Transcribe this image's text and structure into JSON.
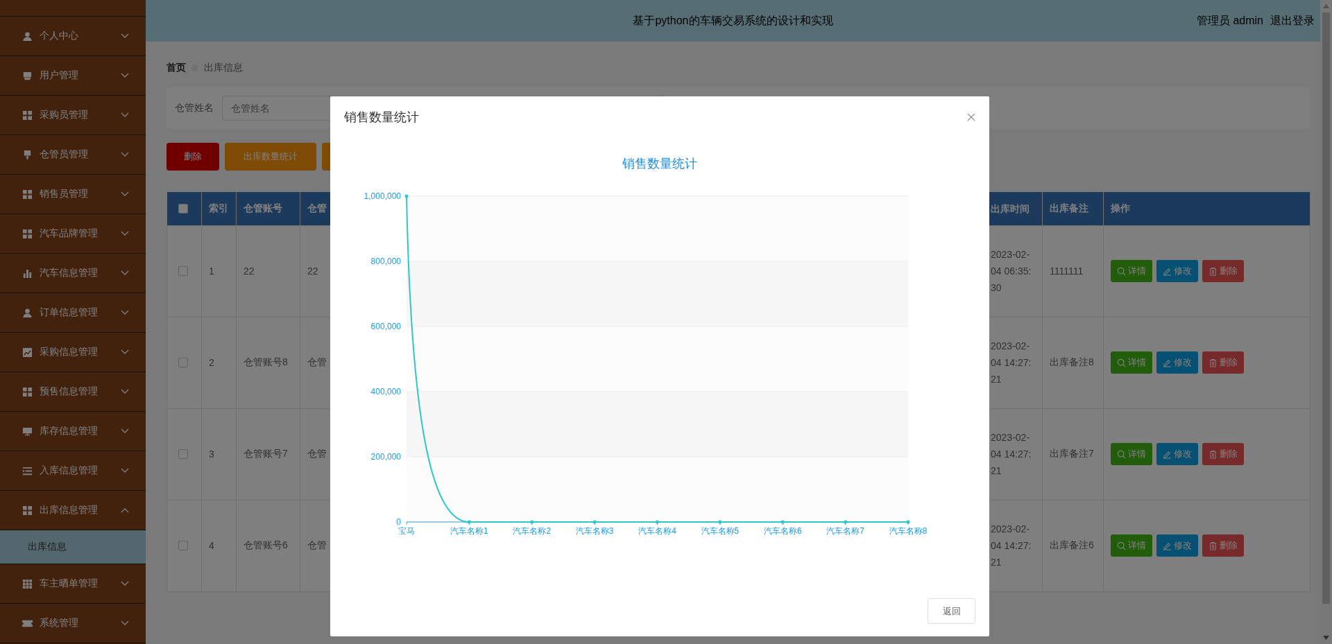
{
  "sidebar": {
    "items": [
      {
        "label": "个人中心",
        "expanded": false
      },
      {
        "label": "用户管理",
        "expanded": false
      },
      {
        "label": "采购员管理",
        "expanded": false
      },
      {
        "label": "仓管员管理",
        "expanded": false
      },
      {
        "label": "销售员管理",
        "expanded": false
      },
      {
        "label": "汽车品牌管理",
        "expanded": false
      },
      {
        "label": "汽车信息管理",
        "expanded": false
      },
      {
        "label": "订单信息管理",
        "expanded": false
      },
      {
        "label": "采购信息管理",
        "expanded": false
      },
      {
        "label": "预售信息管理",
        "expanded": false
      },
      {
        "label": "库存信息管理",
        "expanded": false
      },
      {
        "label": "入库信息管理",
        "expanded": false
      },
      {
        "label": "出库信息管理",
        "expanded": true,
        "children": [
          {
            "label": "出库信息",
            "selected": true
          }
        ]
      },
      {
        "label": "车主晒单管理",
        "expanded": false
      },
      {
        "label": "系统管理",
        "expanded": false
      }
    ]
  },
  "header": {
    "title": "基于python的车辆交易系统的设计和实现",
    "user": "管理员 admin",
    "logout": "退出登录"
  },
  "breadcrumb": [
    "首页",
    "出库信息"
  ],
  "search": {
    "label": "仓管姓名",
    "placeholder": "仓管姓名"
  },
  "toolbar": [
    {
      "label": "删除",
      "kind": "danger"
    },
    {
      "label": "出库数量统计",
      "kind": "warning"
    },
    {
      "kind": "warning"
    }
  ],
  "table": {
    "select_all": {
      "checked": false
    },
    "columns": [
      "索引",
      "仓管账号",
      "仓管",
      "出库时间",
      "出库备注",
      "操作"
    ],
    "rows": [
      {
        "checked": false,
        "index": "1",
        "account": "22",
        "column_4": "22",
        "time": "2023-02-04 06:35:30",
        "note": "1111111",
        "actions": [
          "详情",
          "修改",
          "删除"
        ]
      },
      {
        "checked": false,
        "index": "2",
        "account": "仓管账号8",
        "column_4": "仓管",
        "time": "2023-02-04 14:27:21",
        "note": "出库备注8",
        "actions": [
          "详情",
          "修改",
          "删除"
        ]
      },
      {
        "checked": false,
        "index": "3",
        "account": "仓管账号7",
        "column_4": "仓管",
        "time": "2023-02-04 14:27:21",
        "note": "出库备注7",
        "actions": [
          "详情",
          "修改",
          "删除"
        ]
      },
      {
        "checked": false,
        "index": "4",
        "account": "仓管账号6",
        "column_4": "仓管",
        "time": "2023-02-04 14:27:21",
        "note": "出库备注6",
        "actions": [
          "详情",
          "修改",
          "删除"
        ]
      }
    ]
  },
  "modal": {
    "title": "销售数量统计",
    "buttons": [
      "返回"
    ],
    "chart_data": {
      "type": "line",
      "title": "销售数量统计",
      "categories": [
        "宝马",
        "汽车名称1",
        "汽车名称2",
        "汽车名称3",
        "汽车名称4",
        "汽车名称5",
        "汽车名称6",
        "汽车名称7",
        "汽车名称8"
      ],
      "series": [
        {
          "color": "#2ec7c9",
          "values": [
            1000000,
            0,
            0,
            0,
            0,
            0,
            0,
            0,
            0
          ]
        }
      ],
      "ylim": [
        0,
        1000000
      ],
      "grid": true,
      "yticks": [
        {
          "value": 0,
          "label": "0"
        },
        {
          "value": 200000,
          "label": "200,000"
        },
        {
          "value": 400000,
          "label": "400,000"
        },
        {
          "value": 600000,
          "label": "600,000"
        },
        {
          "value": 800000,
          "label": "800,000"
        },
        {
          "value": 1000000,
          "label": "1,000,000"
        }
      ]
    }
  }
}
